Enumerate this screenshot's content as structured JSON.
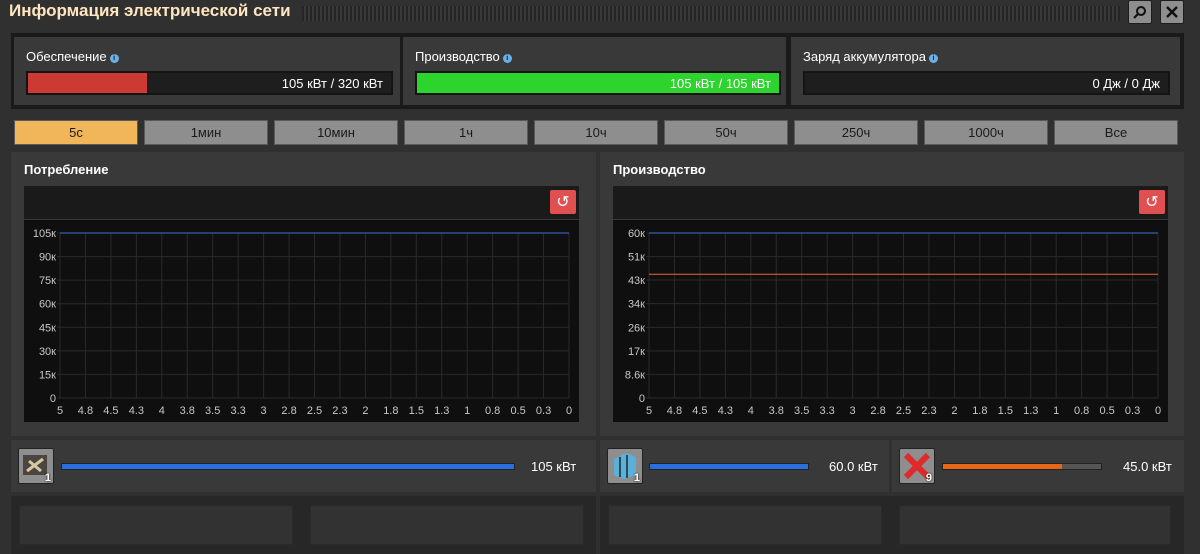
{
  "window": {
    "title": "Информация электрической сети",
    "search_icon": "search-icon",
    "close_icon": "close-icon"
  },
  "stats": {
    "satisfaction": {
      "label": "Обеспечение",
      "value": "105 кВт / 320 кВт",
      "fraction": 0.328,
      "color": "#cc3a33"
    },
    "production": {
      "label": "Производство",
      "value": "105 кВт / 105 кВт",
      "fraction": 1.0,
      "color": "#2dd42d"
    },
    "accumulator": {
      "label": "Заряд аккумулятора",
      "value": "0 Дж / 0 Дж",
      "fraction": 0.0,
      "color": "#2dd42d"
    }
  },
  "tabs": [
    "5с",
    "1мин",
    "10мин",
    "1ч",
    "10ч",
    "50ч",
    "250ч",
    "1000ч",
    "Все"
  ],
  "active_tab": 0,
  "consumption_graph": {
    "title": "Потребление",
    "reset_icon": "reset-icon",
    "chart_data": {
      "type": "line",
      "y_ticks": [
        "105к",
        "90к",
        "75к",
        "60к",
        "45к",
        "30к",
        "15к",
        "0"
      ],
      "y_tick_values": [
        105,
        90,
        75,
        60,
        45,
        30,
        15,
        0
      ],
      "x_ticks": [
        "5",
        "4.8",
        "4.5",
        "4.3",
        "4",
        "3.8",
        "3.5",
        "3.3",
        "3",
        "2.8",
        "2.5",
        "2.3",
        "2",
        "1.8",
        "1.5",
        "1.3",
        "1",
        "0.8",
        "0.5",
        "0.3",
        "0"
      ],
      "ylim": [
        0,
        105
      ],
      "series": [
        {
          "values": [
            105,
            105
          ],
          "color": "#3d6fe0"
        }
      ]
    }
  },
  "production_graph": {
    "title": "Производство",
    "reset_icon": "reset-icon",
    "chart_data": {
      "type": "line",
      "y_ticks": [
        "60к",
        "51к",
        "43к",
        "34к",
        "26к",
        "17к",
        "8.6к",
        "0"
      ],
      "y_tick_values": [
        60,
        51.4,
        42.9,
        34.3,
        25.7,
        17.1,
        8.6,
        0
      ],
      "x_ticks": [
        "5",
        "4.8",
        "4.5",
        "4.3",
        "4",
        "3.8",
        "3.5",
        "3.3",
        "3",
        "2.8",
        "2.5",
        "2.3",
        "2",
        "1.8",
        "1.5",
        "1.3",
        "1",
        "0.8",
        "0.5",
        "0.3",
        "0"
      ],
      "ylim": [
        0,
        60
      ],
      "series": [
        {
          "values": [
            60,
            60
          ],
          "color": "#3d6fe0"
        },
        {
          "values": [
            45,
            45
          ],
          "color": "#e8663a"
        }
      ]
    }
  },
  "consumers": [
    {
      "icon": "lab-icon",
      "count": "1",
      "value": "105 кВт",
      "fraction": 1.0,
      "color": "#2a6fe0"
    }
  ],
  "producers": [
    {
      "icon": "solar-panel-icon",
      "count": "1",
      "value": "60.0 кВт",
      "fraction": 1.0,
      "color": "#2a6fe0"
    },
    {
      "icon": "steam-engine-icon",
      "count": "9",
      "value": "45.0 кВт",
      "fraction": 0.75,
      "color": "#e8661a"
    }
  ]
}
